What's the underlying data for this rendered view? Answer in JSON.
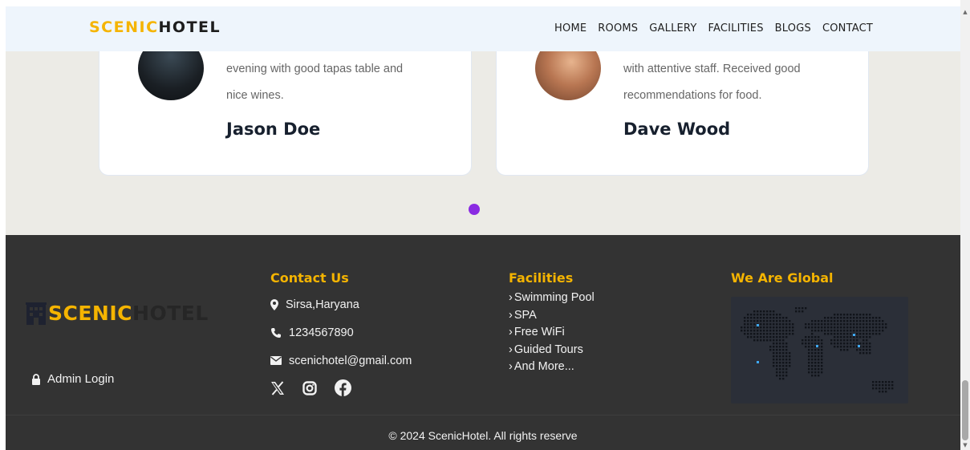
{
  "navbar": {
    "logo_part1": "SCENIC",
    "logo_part2": "HOTEL",
    "links": [
      "HOME",
      "ROOMS",
      "GALLERY",
      "FACILITIES",
      "BLOGS",
      "CONTACT"
    ]
  },
  "testimonials": [
    {
      "quote_lines": [
        "evening with good tapas table and",
        "nice wines."
      ],
      "author": "Jason Doe"
    },
    {
      "quote_lines": [
        "with attentive staff. Received good",
        "recommendations for food."
      ],
      "author": "Dave Wood"
    }
  ],
  "footer": {
    "logo_part1": "SCENIC",
    "logo_part2": "HOTEL",
    "admin_login": "Admin Login",
    "contact": {
      "heading": "Contact Us",
      "address": "Sirsa,Haryana",
      "phone": "1234567890",
      "email": "scenichotel@gmail.com"
    },
    "social_icons": [
      "x-icon",
      "instagram-icon",
      "facebook-icon"
    ],
    "facilities": {
      "heading": "Facilities",
      "items": [
        "Swimming Pool",
        "SPA",
        "Free WiFi",
        "Guided Tours",
        "And More..."
      ]
    },
    "global": {
      "heading": "We Are Global"
    },
    "copyright": "© 2024 ScenicHotel. All rights reserve"
  },
  "colors": {
    "brand": "#f5b400",
    "carousel_dot": "#8a2be2",
    "footer_bg": "#333333",
    "nav_bg": "#eef5fc"
  }
}
